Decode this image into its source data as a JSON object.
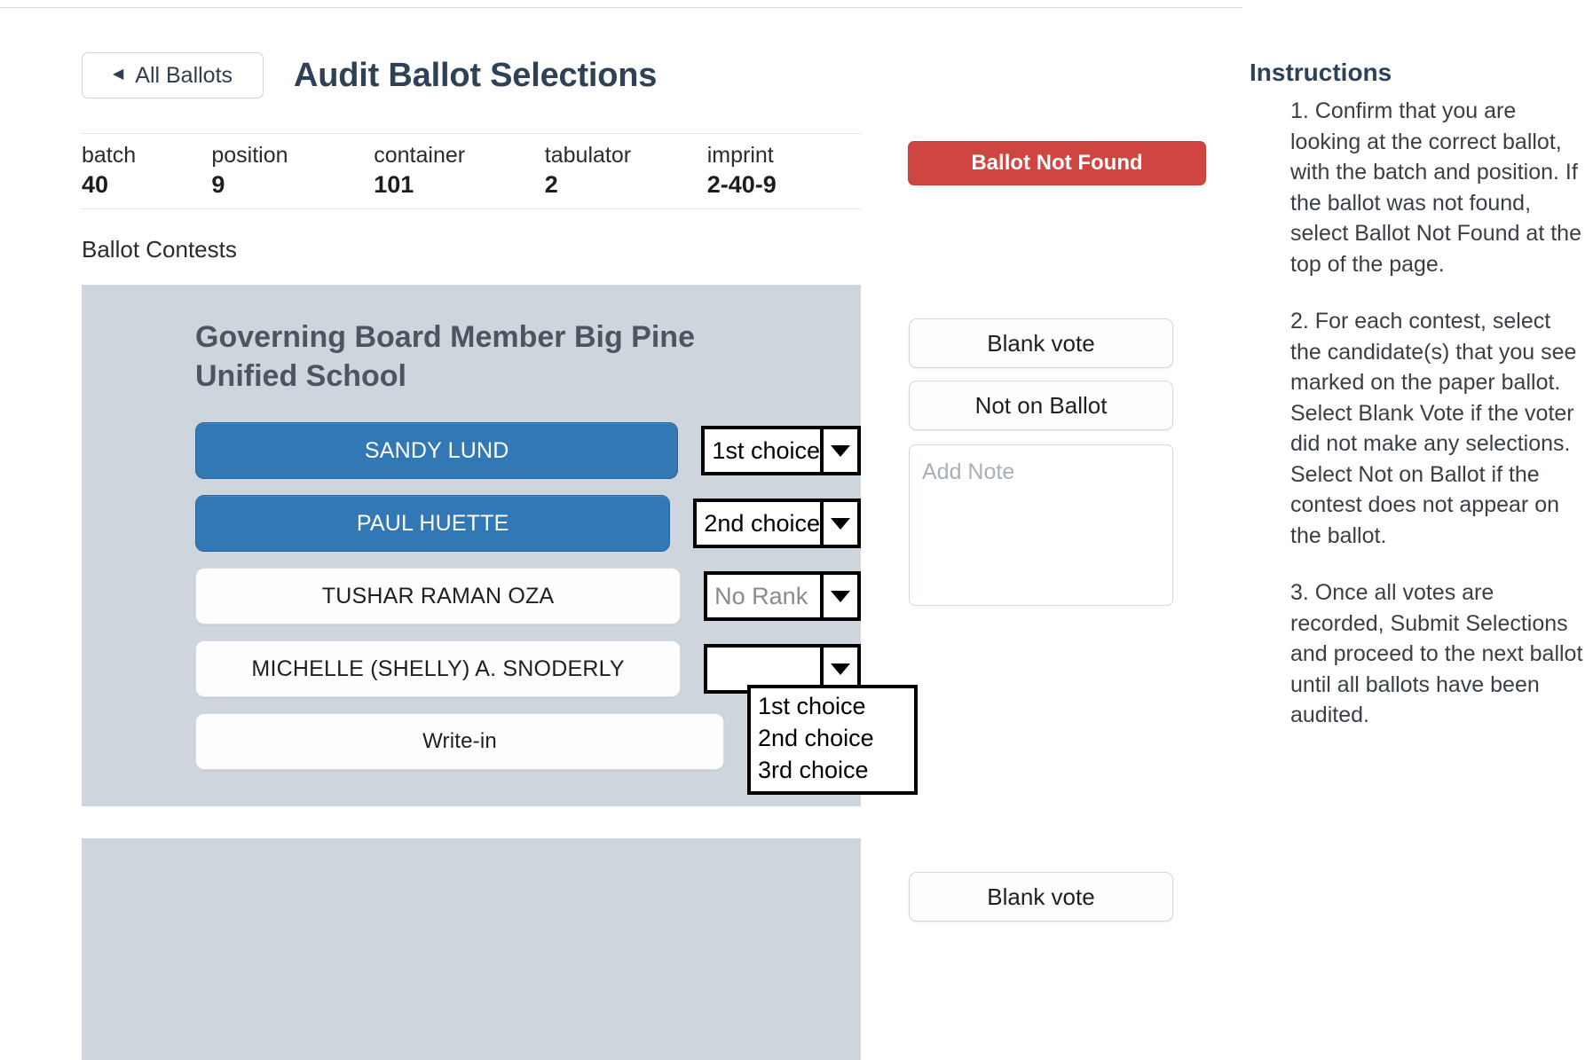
{
  "header": {
    "back_button_label": "All Ballots",
    "back_caret": "◀",
    "page_title": "Audit Ballot Selections"
  },
  "ballot_meta": {
    "fields": [
      {
        "label": "batch",
        "value": "40"
      },
      {
        "label": "position",
        "value": "9"
      },
      {
        "label": "container",
        "value": "101"
      },
      {
        "label": "tabulator",
        "value": "2"
      },
      {
        "label": "imprint",
        "value": "2-40-9"
      }
    ],
    "not_found_button_label": "Ballot Not Found",
    "not_found_button_color": "#cf4541"
  },
  "contests_heading": "Ballot Contests",
  "contests": [
    {
      "title": "Governing Board Member Big Pine Unified School",
      "candidates": [
        {
          "name": "SANDY LUND",
          "selected": true,
          "rank": "1st choice",
          "rank_placeholder": false,
          "open": false
        },
        {
          "name": "PAUL HUETTE",
          "selected": true,
          "rank": "2nd choice",
          "rank_placeholder": false,
          "open": false
        },
        {
          "name": "TUSHAR RAMAN OZA",
          "selected": false,
          "rank": "No Rank",
          "rank_placeholder": true,
          "open": false
        },
        {
          "name": "MICHELLE (SHELLY) A. SNODERLY",
          "selected": false,
          "rank": "",
          "rank_placeholder": false,
          "open": true
        },
        {
          "name": "Write-in",
          "selected": false,
          "rank": null,
          "rank_placeholder": false,
          "open": false
        }
      ],
      "rank_options": [
        "1st choice",
        "2nd choice",
        "3rd choice"
      ],
      "actions": {
        "blank_vote_label": "Blank vote",
        "not_on_ballot_label": "Not on Ballot",
        "note_placeholder": "Add Note",
        "note_value": ""
      }
    }
  ],
  "instructions": {
    "title": "Instructions",
    "items": [
      "1. Confirm that you are looking at the correct ballot, with the batch and position. If the ballot was not found, select Ballot Not Found at the top of the page.",
      "2. For each contest, select the candidate(s) that you see marked on the paper ballot. Select Blank Vote if the voter did not make any selections. Select Not on Ballot if the contest does not appear on the ballot.",
      "3. Once all votes are recorded, Submit Selections and proceed to the next ballot until all ballots have been audited."
    ]
  },
  "theme": {
    "selected_blue": "#3178b4",
    "card_gray": "#ced5dd",
    "title_navy": "#2e4156"
  }
}
